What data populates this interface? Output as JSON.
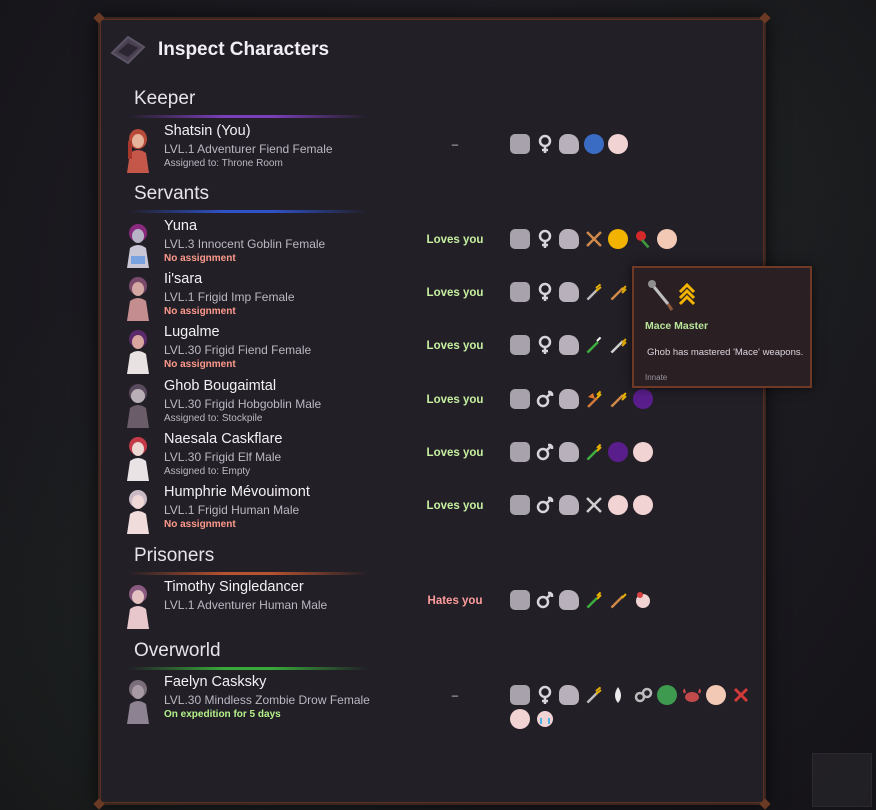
{
  "window": {
    "title": "Inspect Characters",
    "icon": "panel-tile-icon"
  },
  "sections": {
    "keeper": "Keeper",
    "servants": "Servants",
    "prisoners": "Prisoners",
    "overworld": "Overworld"
  },
  "colors": {
    "keeper_line": "#7a3fb8",
    "servants_line": "#2e52c8",
    "prisoners_line": "#b5522f",
    "overworld_line": "#38a83a",
    "panel_border": "#6e3a26"
  },
  "characters": [
    {
      "name": "Shatsin (You)",
      "sub": "LVL.1 Adventurer Fiend Female",
      "assignment": "Assigned to: Throne Room",
      "relation": "–"
    },
    {
      "name": "Yuna",
      "sub": "LVL.3 Innocent Goblin Female",
      "assignment": "No assignment",
      "relation": "Loves you"
    },
    {
      "name": "Ii'sara",
      "sub": "LVL.1 Frigid Imp Female",
      "assignment": "No assignment",
      "relation": "Loves you"
    },
    {
      "name": "Lugalme",
      "sub": "LVL.30 Frigid Fiend Female",
      "assignment": "No assignment",
      "relation": "Loves you"
    },
    {
      "name": "Ghob Bougaimtal",
      "sub": "LVL.30 Frigid Hobgoblin Male",
      "assignment": "Assigned to: Stockpile",
      "relation": "Loves you"
    },
    {
      "name": "Naesala Caskflare",
      "sub": "LVL.30 Frigid Elf Male",
      "assignment": "Assigned to: Empty",
      "relation": "Loves you"
    },
    {
      "name": "Humphrie Mévouimont",
      "sub": "LVL.1 Frigid Human Male",
      "assignment": "No assignment",
      "relation": "Loves you"
    },
    {
      "name": "Timothy Singledancer",
      "sub": "LVL.1 Adventurer Human Male",
      "assignment": "",
      "relation": "Hates you"
    },
    {
      "name": "Faelyn Casksky",
      "sub": "LVL.30 Mindless Zombie Drow Female",
      "assignment": "On expedition for 5 days",
      "relation": "–"
    }
  ],
  "tooltip": {
    "title": "Mace Master",
    "description": "Ghob  has mastered 'Mace' weapons.",
    "footer": "Innate",
    "icons": [
      "mace-icon",
      "rank-chevrons-icon"
    ]
  }
}
